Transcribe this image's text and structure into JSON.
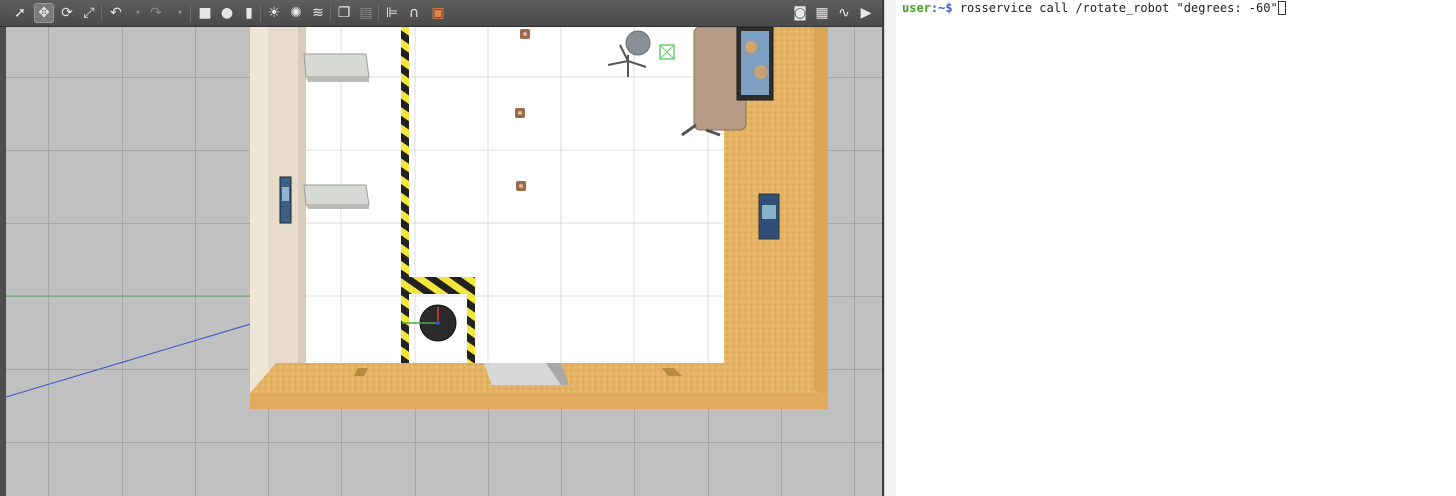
{
  "toolbar": {
    "tools": [
      {
        "name": "select-mode-icon",
        "glyph": "➚"
      },
      {
        "name": "translate-mode-icon",
        "glyph": "✥"
      },
      {
        "name": "rotate-mode-icon",
        "glyph": "⟳"
      },
      {
        "name": "scale-mode-icon",
        "glyph": "⤢"
      },
      {
        "name": "undo-icon",
        "glyph": "↶"
      },
      {
        "name": "redo-icon",
        "glyph": "↷"
      },
      {
        "name": "box-shape-icon",
        "glyph": "■"
      },
      {
        "name": "sphere-shape-icon",
        "glyph": "●"
      },
      {
        "name": "cylinder-shape-icon",
        "glyph": "▮"
      },
      {
        "name": "point-light-icon",
        "glyph": "☀"
      },
      {
        "name": "spot-light-icon",
        "glyph": "✺"
      },
      {
        "name": "directional-light-icon",
        "glyph": "≋"
      },
      {
        "name": "copy-icon",
        "glyph": "❐"
      },
      {
        "name": "paste-icon",
        "glyph": "▤"
      },
      {
        "name": "align-icon",
        "glyph": "⊫"
      },
      {
        "name": "snap-icon",
        "glyph": "∩"
      },
      {
        "name": "change-view-icon",
        "glyph": "▣"
      },
      {
        "name": "screenshot-icon",
        "glyph": "◙"
      },
      {
        "name": "log-icon",
        "glyph": "▦"
      },
      {
        "name": "plot-icon",
        "glyph": "∿"
      },
      {
        "name": "video-record-icon",
        "glyph": "▶"
      }
    ]
  },
  "terminal": {
    "user": "user",
    "path": ":~$",
    "command": " rosservice call /rotate_robot \"degrees: -60\""
  },
  "colors": {
    "wood": "#e6b86a",
    "hazard_yellow": "#f2e234",
    "grid_bg": "#c0c0c0",
    "floor": "#ffffff"
  }
}
